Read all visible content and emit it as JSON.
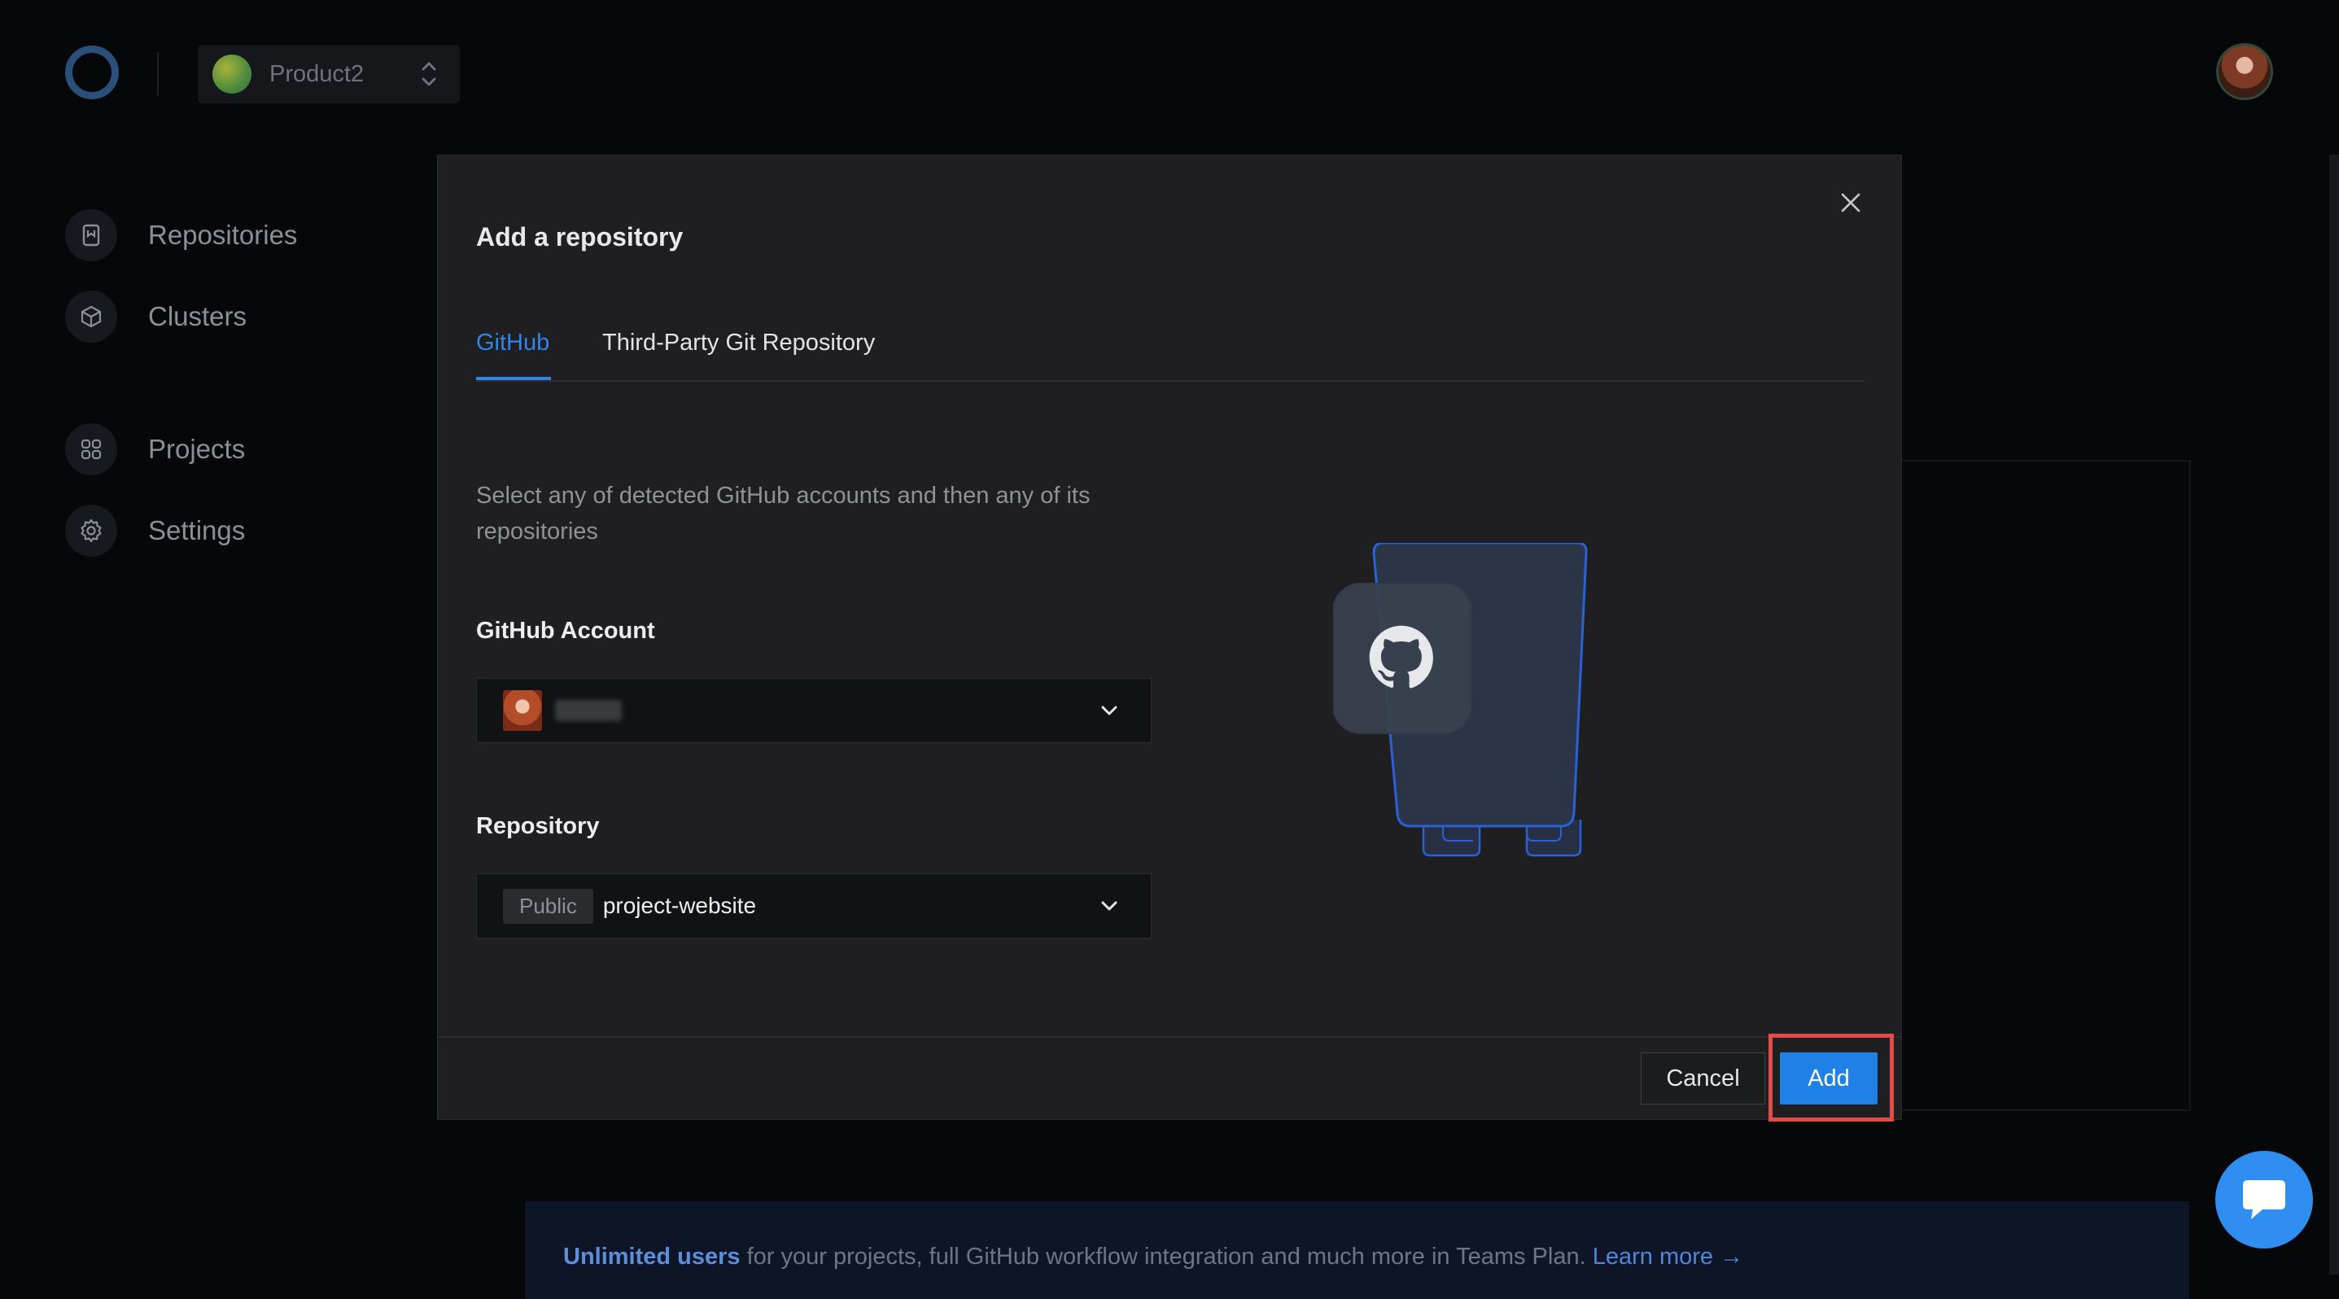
{
  "header": {
    "project_name": "Product2"
  },
  "sidebar": {
    "items": [
      {
        "label": "Repositories",
        "icon": "bookmark-icon"
      },
      {
        "label": "Clusters",
        "icon": "cube-icon"
      },
      {
        "label": "Projects",
        "icon": "grid-icon"
      },
      {
        "label": "Settings",
        "icon": "gear-icon"
      }
    ]
  },
  "banner": {
    "highlight": "Unlimited users",
    "text": " for your projects, full GitHub workflow integration and much more in Teams Plan. ",
    "link": "Learn more →"
  },
  "modal": {
    "title": "Add a repository",
    "tabs": [
      {
        "label": "GitHub",
        "active": true
      },
      {
        "label": "Third-Party Git Repository",
        "active": false
      }
    ],
    "description": "Select any of detected GitHub accounts and then any of its repositories",
    "account_label": "GitHub Account",
    "repository_label": "Repository",
    "repository": {
      "visibility": "Public",
      "name": "project-website"
    },
    "cancel_label": "Cancel",
    "add_label": "Add"
  },
  "colors": {
    "accent": "#1f80e6",
    "highlight_box": "#e24c48",
    "background": "#060709",
    "modal_bg": "#1f1f21"
  }
}
